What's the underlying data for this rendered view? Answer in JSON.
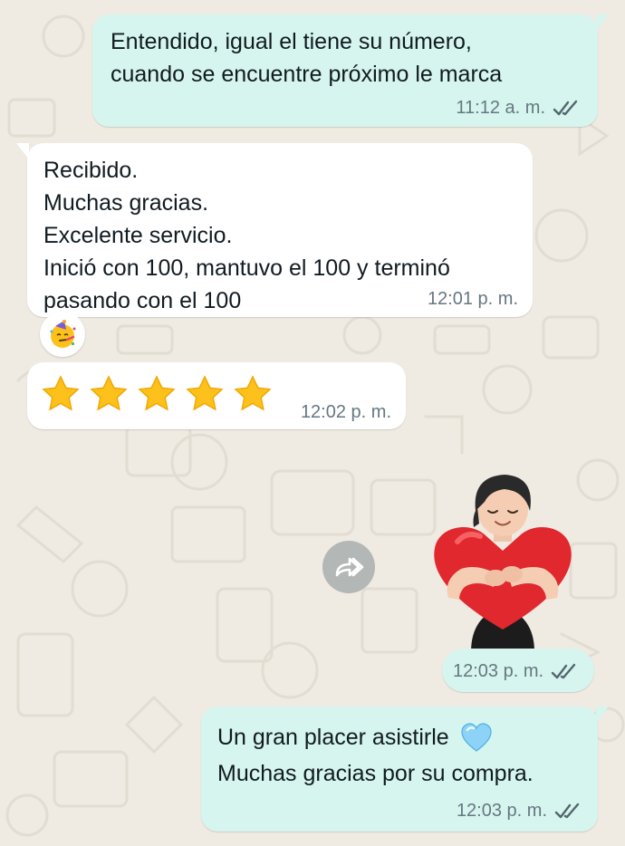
{
  "messages": [
    {
      "direction": "outgoing",
      "lines": [
        "Entendido, igual el tiene su número,",
        "cuando se encuentre próximo le marca"
      ],
      "time": "11:12 a. m.",
      "status": "read"
    },
    {
      "direction": "incoming",
      "lines": [
        "Recibido.",
        "Muchas gracias.",
        "Excelente servicio.",
        "Inició con 100, mantuvo el 100 y terminó",
        "pasando con el 100"
      ],
      "time": "12:01 p. m.",
      "reaction": "party-face-emoji"
    },
    {
      "direction": "incoming",
      "stars": 5,
      "time": "12:02 p. m."
    },
    {
      "direction": "outgoing",
      "type": "sticker",
      "sticker": "girl-hugging-red-heart-sticker",
      "time": "12:03 p. m.",
      "status": "read"
    },
    {
      "direction": "outgoing",
      "lines": [
        "Un gran placer asistirle",
        "Muchas gracias por su compra."
      ],
      "emoji": "light-blue-heart-emoji",
      "time": "12:03 p. m.",
      "status": "read"
    }
  ],
  "icons": {
    "forward": "forward-icon",
    "read_ticks": "double-check-icon"
  },
  "colors": {
    "background": "#efeae2",
    "outgoing_bubble": "#d6f5ee",
    "incoming_bubble": "#ffffff",
    "meta_text": "#667781",
    "read_ticks": "#54656f"
  }
}
